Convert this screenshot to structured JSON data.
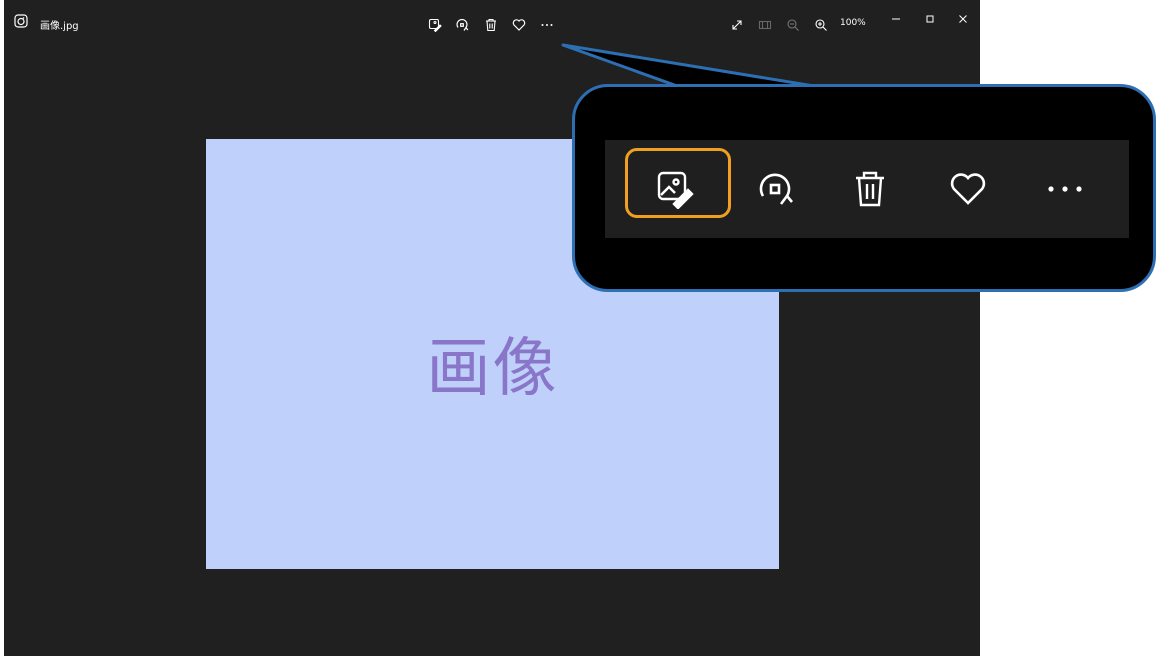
{
  "window": {
    "title": "画像.jpg",
    "zoom_level": "100%",
    "toolbar_icons": [
      "edit-image-icon",
      "rotate-icon",
      "delete-icon",
      "favorite-icon",
      "more-icon"
    ],
    "right_icons": [
      "fullscreen-icon",
      "filmstrip-icon",
      "zoom-out-icon",
      "zoom-in-icon"
    ],
    "window_controls": [
      "minimize-icon",
      "maximize-icon",
      "close-icon"
    ]
  },
  "image": {
    "text": "画像",
    "background_color": "#bfd0fa",
    "text_color": "#8a76c8"
  },
  "callout": {
    "border_color": "#2c6fb3",
    "highlight_color": "#f0a020",
    "highlighted_icon": "edit-image-icon",
    "icons": [
      "edit-image-icon",
      "rotate-icon",
      "delete-icon",
      "favorite-icon",
      "more-icon"
    ]
  }
}
